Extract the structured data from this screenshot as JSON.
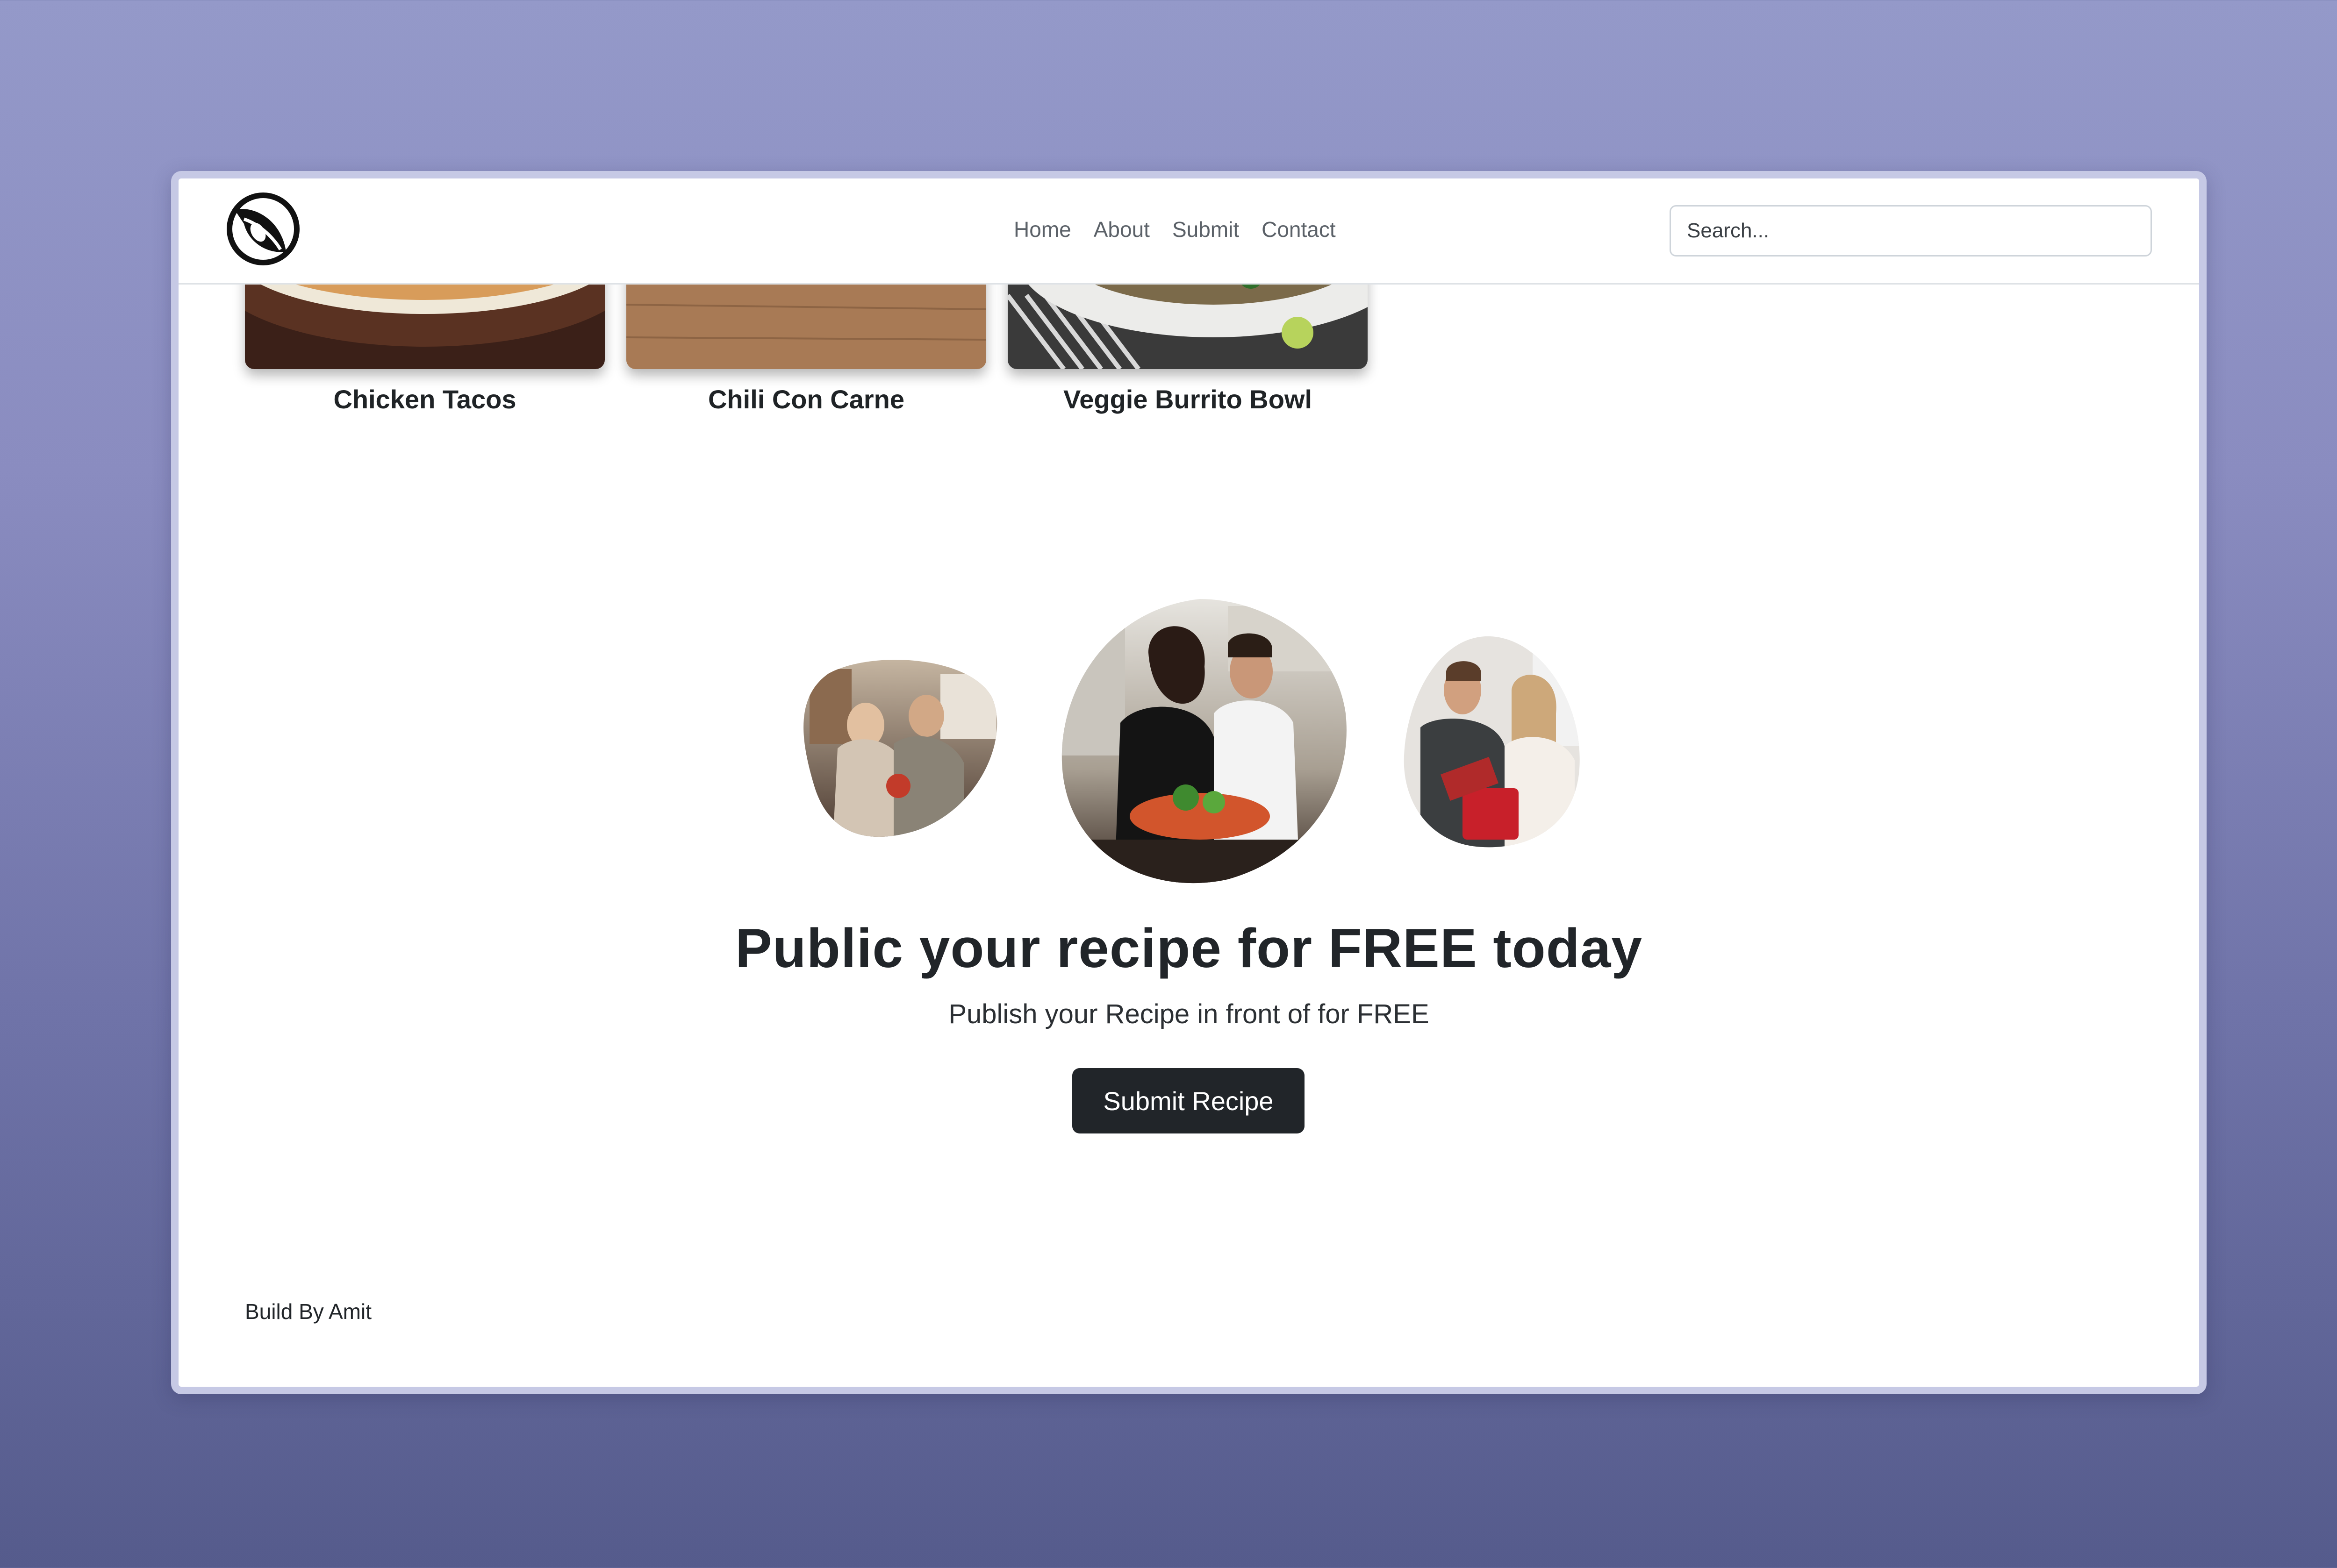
{
  "header": {
    "logo_icon": "leaf-circle-logo-icon",
    "nav": [
      "Home",
      "About",
      "Submit",
      "Contact"
    ],
    "search_placeholder": "Search..."
  },
  "recipes": [
    {
      "title": "Chicken Tacos",
      "image_icon": "chicken-tacos-photo"
    },
    {
      "title": "Chili Con Carne",
      "image_icon": "chili-con-carne-photo"
    },
    {
      "title": "Veggie Burrito Bowl",
      "image_icon": "veggie-burrito-bowl-photo"
    }
  ],
  "cta": {
    "headline": "Public your recipe for FREE today",
    "subline": "Publish your Recipe in front of for FREE",
    "button": "Submit Recipe"
  },
  "footer": {
    "text": "Build By Amit"
  }
}
